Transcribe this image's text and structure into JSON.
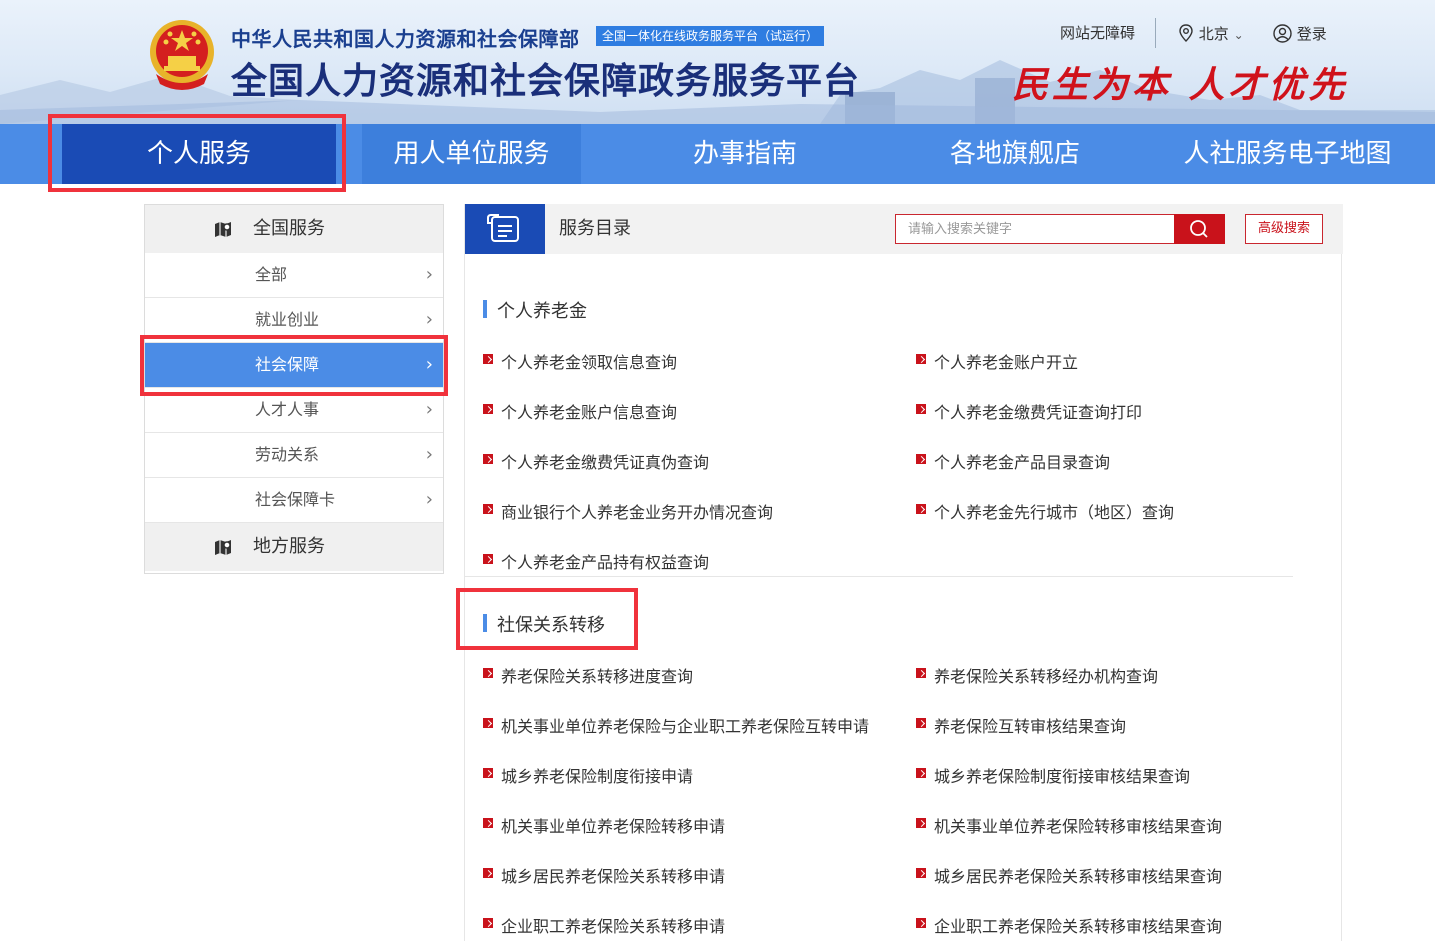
{
  "header": {
    "ministry": "中华人民共和国人力资源和社会保障部",
    "badge": "全国一体化在线政务服务平台（试运行）",
    "platform": "全国人力资源和社会保障政务服务平台",
    "accessibility": "网站无障碍",
    "location": "北京",
    "login": "登录",
    "slogan": "民生为本 人才优先"
  },
  "nav": {
    "items": [
      {
        "label": "个人服务"
      },
      {
        "label": "用人单位服务"
      },
      {
        "label": "办事指南"
      },
      {
        "label": "各地旗舰店"
      },
      {
        "label": "人社服务电子地图"
      }
    ]
  },
  "sidebar": {
    "national": "全国服务",
    "items": [
      {
        "label": "全部"
      },
      {
        "label": "就业创业"
      },
      {
        "label": "社会保障"
      },
      {
        "label": "人才人事"
      },
      {
        "label": "劳动关系"
      },
      {
        "label": "社会保障卡"
      }
    ],
    "local": "地方服务"
  },
  "panel": {
    "title": "服务目录",
    "search_placeholder": "请输入搜索关键字",
    "advanced": "高级搜索"
  },
  "sections": [
    {
      "title": "个人养老金",
      "services": [
        "个人养老金领取信息查询",
        "个人养老金账户开立",
        "个人养老金账户信息查询",
        "个人养老金缴费凭证查询打印",
        "个人养老金缴费凭证真伪查询",
        "个人养老金产品目录查询",
        "商业银行个人养老金业务开办情况查询",
        "个人养老金先行城市（地区）查询",
        "个人养老金产品持有权益查询"
      ]
    },
    {
      "title": "社保关系转移",
      "services": [
        "养老保险关系转移进度查询",
        "养老保险关系转移经办机构查询",
        "机关事业单位养老保险与企业职工养老保险互转申请",
        "养老保险互转审核结果查询",
        "城乡养老保险制度衔接申请",
        "城乡养老保险制度衔接审核结果查询",
        "机关事业单位养老保险转移申请",
        "机关事业单位养老保险转移审核结果查询",
        "城乡居民养老保险关系转移申请",
        "城乡居民养老保险关系转移审核结果查询",
        "企业职工养老保险关系转移申请",
        "企业职工养老保险关系转移审核结果查询"
      ]
    }
  ],
  "colors": {
    "nav_blue": "#4b8ce6",
    "nav_active": "#1a4bb5",
    "accent_red": "#c9121b",
    "annotation_red": "#f0323c"
  },
  "icons": {
    "location": "location-pin-icon",
    "user": "user-icon",
    "search": "search-icon",
    "catalog": "catalog-icon",
    "map": "map-icon"
  }
}
